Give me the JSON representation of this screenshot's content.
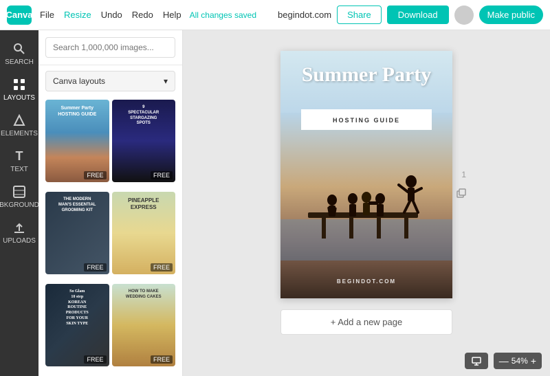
{
  "topnav": {
    "logo": "Canva",
    "menu": [
      "File",
      "Resize",
      "Undo",
      "Redo",
      "Help"
    ],
    "resize_label": "Resize",
    "autosave": "All changes saved",
    "site_label": "begindot.com",
    "share_label": "Share",
    "download_label": "Download",
    "public_label": "Make public"
  },
  "sidebar": {
    "items": [
      {
        "id": "search",
        "label": "SEARCH",
        "icon": "🔍"
      },
      {
        "id": "layouts",
        "label": "LAYOUTS",
        "icon": "▦"
      },
      {
        "id": "elements",
        "label": "ELEMENTS",
        "icon": "✦"
      },
      {
        "id": "text",
        "label": "TEXT",
        "icon": "T"
      },
      {
        "id": "background",
        "label": "BKGROUND",
        "icon": "▤"
      },
      {
        "id": "uploads",
        "label": "UPLOADS",
        "icon": "↑"
      }
    ]
  },
  "panel": {
    "search_placeholder": "Search 1,000,000 images...",
    "dropdown_label": "Canva layouts",
    "templates": [
      {
        "id": 1,
        "title": "Summer Party Hosting Guide",
        "free": true,
        "style": "tmpl-1"
      },
      {
        "id": 2,
        "title": "9 Spectacular Stargazing Spots",
        "free": true,
        "style": "tmpl-2"
      },
      {
        "id": 3,
        "title": "The Modern Man's Essential Grooming Kit",
        "free": true,
        "style": "tmpl-3"
      },
      {
        "id": 4,
        "title": "Pineapple Express",
        "free": true,
        "style": "tmpl-4"
      },
      {
        "id": 5,
        "title": "So Glam 10 Step Korean Routine Products For Your Skin Type",
        "free": true,
        "style": "tmpl-5"
      },
      {
        "id": 6,
        "title": "How To Make Wedding Cakes",
        "free": true,
        "style": "tmpl-6"
      }
    ]
  },
  "canvas": {
    "title_line1": "Summer Party",
    "subtitle": "HOSTING GUIDE",
    "bottom_text": "BEGINDOT.COM",
    "page_number": "1",
    "add_page_label": "+ Add a new page"
  },
  "bottombar": {
    "zoom_label": "54%",
    "zoom_minus": "—",
    "zoom_plus": "+"
  }
}
